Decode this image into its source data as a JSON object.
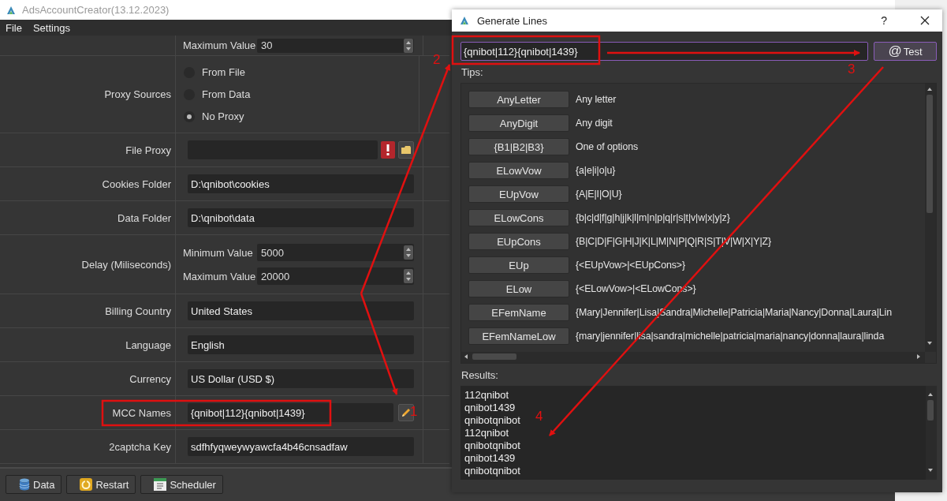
{
  "main_window": {
    "title": "AdsAccountCreator(13.12.2023)",
    "menu": [
      "File",
      "Settings"
    ],
    "form": [
      {
        "kind": "spins",
        "spins": [
          {
            "label": "Maximum Value",
            "value": "30"
          }
        ]
      },
      {
        "kind": "radio",
        "label": "Proxy Sources",
        "options": [
          {
            "label": "From File",
            "selected": false
          },
          {
            "label": "From Data",
            "selected": false
          },
          {
            "label": "No Proxy",
            "selected": true
          }
        ]
      },
      {
        "kind": "file",
        "label": "File Proxy"
      },
      {
        "kind": "text",
        "label": "Cookies Folder",
        "value": "D:\\qnibot\\cookies"
      },
      {
        "kind": "text",
        "label": "Data Folder",
        "value": "D:\\qnibot\\data"
      },
      {
        "kind": "spins",
        "label": "Delay (Miliseconds)",
        "spins": [
          {
            "label": "Minimum Value",
            "value": "5000"
          },
          {
            "label": "Maximum Value",
            "value": "20000"
          }
        ]
      },
      {
        "kind": "text",
        "label": "Billing Country",
        "value": "United States"
      },
      {
        "kind": "text",
        "label": "Language",
        "value": "English"
      },
      {
        "kind": "text",
        "label": "Currency",
        "value": "US Dollar (USD $)"
      },
      {
        "kind": "edit",
        "label": "MCC Names",
        "value": "{qnibot|112}{qnibot|1439}"
      },
      {
        "kind": "text",
        "label": "2captcha Key",
        "value": "sdfhfyqweywyawcfa4b46cnsadfaw"
      }
    ],
    "buttons": [
      {
        "kind": "data",
        "label": "Data"
      },
      {
        "kind": "restart",
        "label": "Restart"
      },
      {
        "kind": "calendar",
        "label": "Scheduler"
      }
    ]
  },
  "dialog": {
    "title": "Generate Lines",
    "help": "?",
    "pattern": "{qnibot|112}{qnibot|1439}",
    "test_button": {
      "icon": "@",
      "label": "Test"
    },
    "tips_label": "Tips:",
    "tips": [
      {
        "button": "AnyLetter",
        "description": "Any letter"
      },
      {
        "button": "AnyDigit",
        "description": "Any digit"
      },
      {
        "button": "{B1|B2|B3}",
        "description": "One of options"
      },
      {
        "button": "ELowVow",
        "description": "{a|e|i|o|u}"
      },
      {
        "button": "EUpVow",
        "description": "{A|E|I|O|U}"
      },
      {
        "button": "ELowCons",
        "description": "{b|c|d|f|g|h|j|k|l|m|n|p|q|r|s|t|v|w|x|y|z}"
      },
      {
        "button": "EUpCons",
        "description": "{B|C|D|F|G|H|J|K|L|M|N|P|Q|R|S|T|V|W|X|Y|Z}"
      },
      {
        "button": "EUp",
        "description": "{<EUpVow>|<EUpCons>}"
      },
      {
        "button": "ELow",
        "description": "{<ELowVow>|<ELowCons>}"
      },
      {
        "button": "EFemName",
        "description": "{Mary|Jennifer|Lisa|Sandra|Michelle|Patricia|Maria|Nancy|Donna|Laura|Lin"
      },
      {
        "button": "EFemNameLow",
        "description": "{mary|jennifer|lisa|sandra|michelle|patricia|maria|nancy|donna|laura|linda"
      }
    ],
    "results_label": "Results:",
    "results": [
      "112qnibot",
      "qnibot1439",
      "qnibotqnibot",
      "112qnibot",
      "qnibotqnibot",
      "qnibot1439",
      "qnibotqnibot"
    ]
  },
  "annotations": [
    {
      "label": "1"
    },
    {
      "label": "2"
    },
    {
      "label": "3"
    },
    {
      "label": "4"
    }
  ]
}
